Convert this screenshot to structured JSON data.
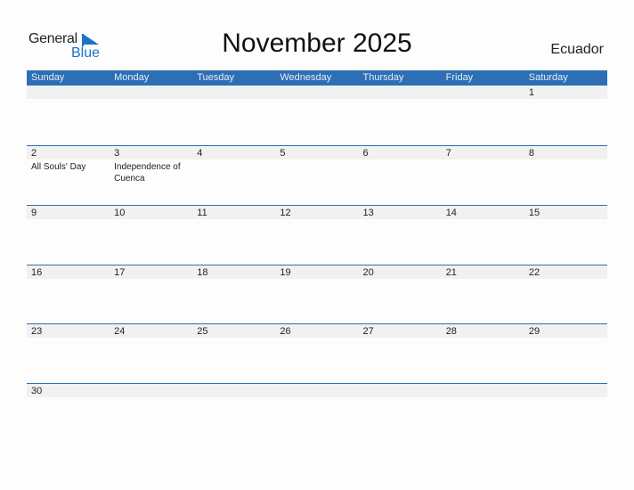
{
  "logo": {
    "general": "General",
    "blue": "Blue"
  },
  "title": "November 2025",
  "country": "Ecuador",
  "weekdays": [
    "Sunday",
    "Monday",
    "Tuesday",
    "Wednesday",
    "Thursday",
    "Friday",
    "Saturday"
  ],
  "weeks": [
    [
      {
        "day": ""
      },
      {
        "day": ""
      },
      {
        "day": ""
      },
      {
        "day": ""
      },
      {
        "day": ""
      },
      {
        "day": ""
      },
      {
        "day": "1"
      }
    ],
    [
      {
        "day": "2",
        "event": "All Souls' Day"
      },
      {
        "day": "3",
        "event": "Independence of Cuenca"
      },
      {
        "day": "4"
      },
      {
        "day": "5"
      },
      {
        "day": "6"
      },
      {
        "day": "7"
      },
      {
        "day": "8"
      }
    ],
    [
      {
        "day": "9"
      },
      {
        "day": "10"
      },
      {
        "day": "11"
      },
      {
        "day": "12"
      },
      {
        "day": "13"
      },
      {
        "day": "14"
      },
      {
        "day": "15"
      }
    ],
    [
      {
        "day": "16"
      },
      {
        "day": "17"
      },
      {
        "day": "18"
      },
      {
        "day": "19"
      },
      {
        "day": "20"
      },
      {
        "day": "21"
      },
      {
        "day": "22"
      }
    ],
    [
      {
        "day": "23"
      },
      {
        "day": "24"
      },
      {
        "day": "25"
      },
      {
        "day": "26"
      },
      {
        "day": "27"
      },
      {
        "day": "28"
      },
      {
        "day": "29"
      }
    ],
    [
      {
        "day": "30"
      },
      {
        "day": ""
      },
      {
        "day": ""
      },
      {
        "day": ""
      },
      {
        "day": ""
      },
      {
        "day": ""
      },
      {
        "day": ""
      }
    ]
  ]
}
